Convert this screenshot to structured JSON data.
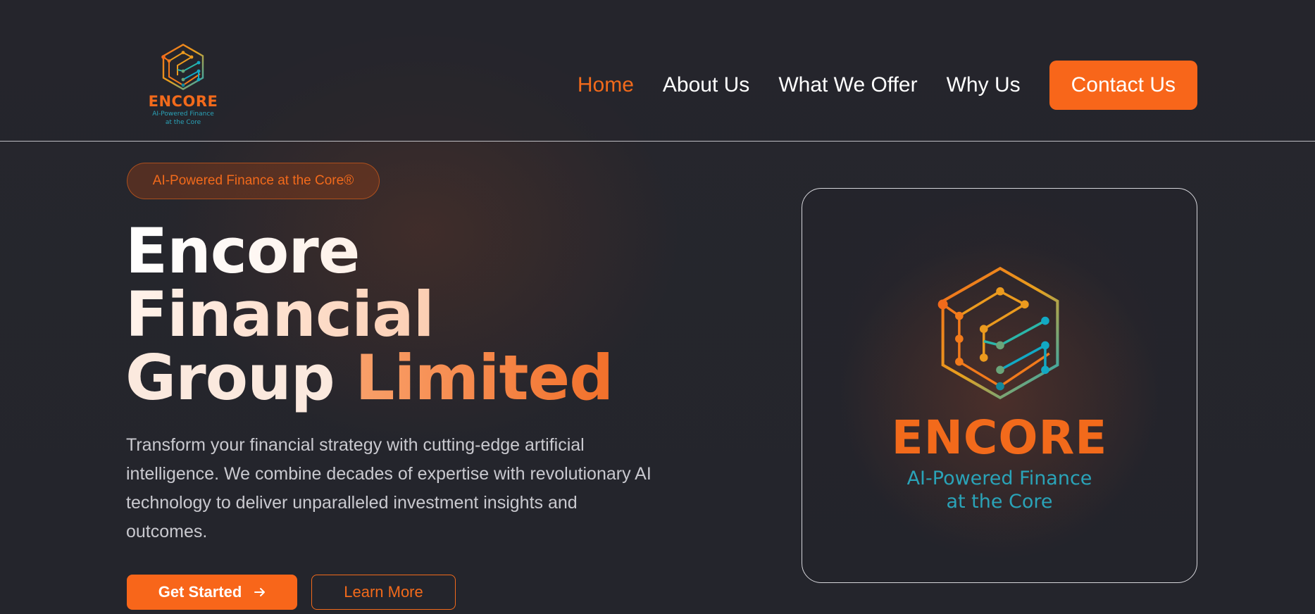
{
  "header": {
    "logo": {
      "brand": "ENCORE",
      "tagline_line1": "AI-Powered Finance",
      "tagline_line2": "at the Core",
      "icon": "hexagon-circuit-logo-icon"
    },
    "nav": {
      "items": [
        {
          "label": "Home",
          "active": true
        },
        {
          "label": "About Us",
          "active": false
        },
        {
          "label": "What We Offer",
          "active": false
        },
        {
          "label": "Why Us",
          "active": false
        }
      ],
      "cta_label": "Contact Us"
    }
  },
  "hero": {
    "badge": "AI-Powered Finance at the Core®",
    "headline": {
      "line1": "Encore",
      "line2": "Financial",
      "line3a": "Group",
      "line3b": "Limited"
    },
    "description": "Transform your financial strategy with cutting-edge artificial intelligence. We combine decades of expertise with revolutionary AI technology to deliver unparalleled investment insights and outcomes.",
    "primary_button": "Get Started",
    "primary_button_icon": "arrow-right-icon",
    "secondary_button": "Learn More"
  },
  "card": {
    "brand": "ENCORE",
    "tagline_line1": "AI-Powered Finance",
    "tagline_line2": "at the Core",
    "icon": "hexagon-circuit-logo-icon"
  },
  "colors": {
    "accent": "#f8661a",
    "teal": "#2aa3b8",
    "background": "#23242b"
  }
}
